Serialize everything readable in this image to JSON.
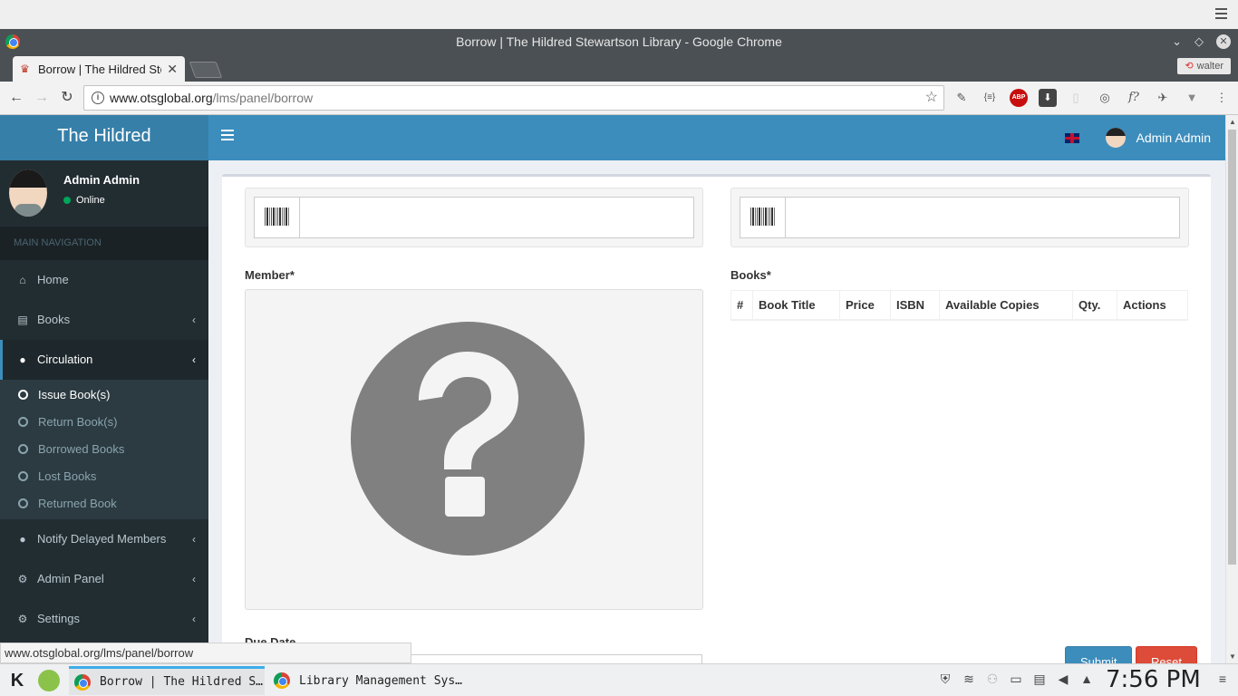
{
  "browser": {
    "window_title": "Borrow | The Hildred Stewartson Library - Google Chrome",
    "tab_title": "Borrow | The Hildred Stewartson Library",
    "profile_name": "walter",
    "url_host": "www.otsglobal.org",
    "url_path": "/lms/panel/borrow",
    "status_url": "www.otsglobal.org/lms/panel/borrow"
  },
  "header": {
    "logo": "The Hildred",
    "user_name": "Admin Admin"
  },
  "sidebar": {
    "user_name": "Admin Admin",
    "status": "Online",
    "nav_header": "MAIN NAVIGATION",
    "items": [
      {
        "label": "Home",
        "icon": "home-icon"
      },
      {
        "label": "Books",
        "icon": "book-icon"
      },
      {
        "label": "Circulation",
        "icon": "user-icon"
      }
    ],
    "submenu": [
      {
        "label": "Issue Book(s)"
      },
      {
        "label": "Return Book(s)"
      },
      {
        "label": "Borrowed Books"
      },
      {
        "label": "Lost Books"
      },
      {
        "label": "Returned Book"
      }
    ],
    "items_after": [
      {
        "label": "Notify Delayed Members",
        "icon": "user-icon"
      },
      {
        "label": "Admin Panel",
        "icon": "gear-icon"
      },
      {
        "label": "Settings",
        "icon": "gears-icon"
      }
    ]
  },
  "form": {
    "member_label": "Member*",
    "books_label": "Books*",
    "due_date_label": "Due Date",
    "columns": [
      "#",
      "Book Title",
      "Price",
      "ISBN",
      "Available Copies",
      "Qty.",
      "Actions"
    ],
    "submit_label": "Submit",
    "reset_label": "Reset"
  },
  "taskbar": {
    "tasks": [
      "Borrow | The Hildred S…",
      "Library Management Sys…"
    ],
    "clock": "7:56 PM"
  },
  "colors": {
    "header": "#3c8dbc",
    "logo": "#367fa9",
    "sidebar": "#222d32",
    "submit": "#3c8dbc",
    "reset": "#dd4b39"
  }
}
